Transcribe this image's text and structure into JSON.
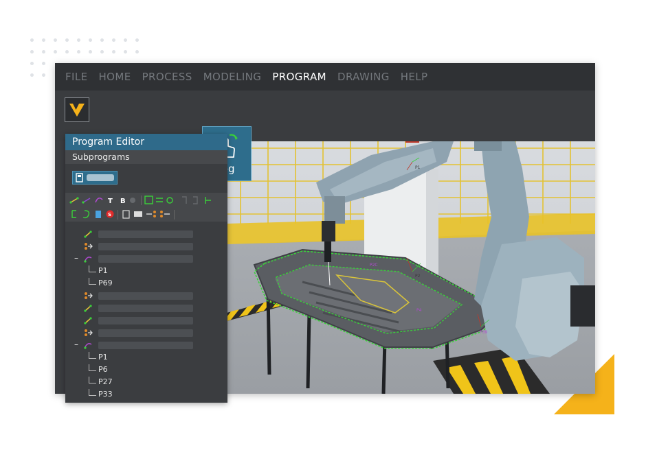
{
  "menu": {
    "items": [
      {
        "label": "FILE",
        "active": false
      },
      {
        "label": "HOME",
        "active": false
      },
      {
        "label": "PROCESS",
        "active": false
      },
      {
        "label": "MODELING",
        "active": false
      },
      {
        "label": "PROGRAM",
        "active": true
      },
      {
        "label": "DRAWING",
        "active": false
      },
      {
        "label": "HELP",
        "active": false
      }
    ]
  },
  "ribbon": {
    "jog_label": "Jog",
    "jog_icon": "hand-pointer-icon"
  },
  "panel": {
    "title": "Program Editor",
    "subtitle": "Subprograms",
    "tree": [
      {
        "icon": "path-yellow-icon"
      },
      {
        "icon": "io-orange-icon"
      },
      {
        "icon": "path-purple-icon",
        "expanded": true,
        "children": [
          "P1",
          "P69"
        ]
      },
      {
        "icon": "io-orange-icon"
      },
      {
        "icon": "path-yellow-icon"
      },
      {
        "icon": "path-yellow-icon"
      },
      {
        "icon": "io-orange-icon"
      },
      {
        "icon": "path-purple-icon",
        "expanded": true,
        "children": [
          "P1",
          "P6",
          "P27",
          "P33"
        ]
      }
    ]
  },
  "toolbar": {
    "t_label": "T",
    "b_label": "B"
  },
  "viewport": {
    "points": [
      "P1",
      "P2",
      "P2C",
      "P4",
      "P69"
    ]
  },
  "colors": {
    "accent": "#2e6d8c",
    "brand": "#f5b21a",
    "path": "#3ad13a"
  }
}
